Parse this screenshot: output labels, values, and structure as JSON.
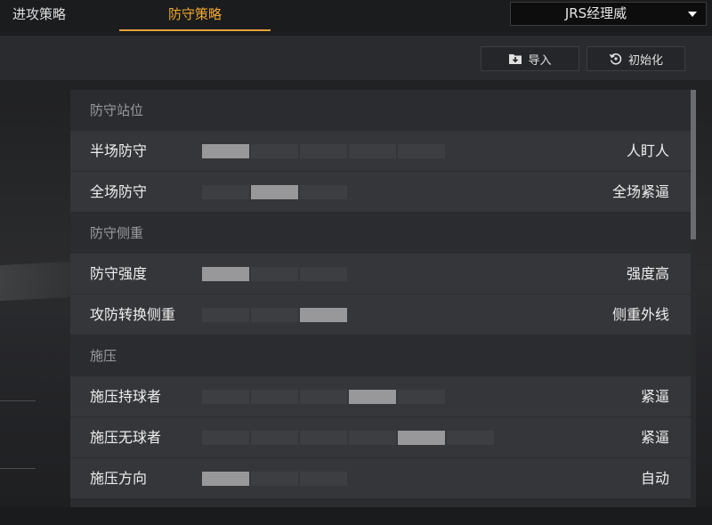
{
  "tabs": [
    {
      "label": "进攻策略"
    },
    {
      "label": "防守策略"
    }
  ],
  "accent_color": "#e3a13a",
  "dropdown": {
    "selected": "JRS经理威"
  },
  "toolbar": {
    "import_label": "导入",
    "reset_label": "初始化"
  },
  "sections": [
    {
      "title": "防守站位",
      "rows": [
        {
          "label": "半场防守",
          "value": "人盯人",
          "segments": 5,
          "selected": 1
        },
        {
          "label": "全场防守",
          "value": "全场紧逼",
          "segments": 3,
          "selected": 2
        }
      ]
    },
    {
      "title": "防守侧重",
      "rows": [
        {
          "label": "防守强度",
          "value": "强度高",
          "segments": 3,
          "selected": 1
        },
        {
          "label": "攻防转换侧重",
          "value": "侧重外线",
          "segments": 3,
          "selected": 3
        }
      ]
    },
    {
      "title": "施压",
      "rows": [
        {
          "label": "施压持球者",
          "value": "紧逼",
          "segments": 5,
          "selected": 4
        },
        {
          "label": "施压无球者",
          "value": "紧逼",
          "segments": 6,
          "selected": 5
        },
        {
          "label": "施压方向",
          "value": "自动",
          "segments": 3,
          "selected": 1
        }
      ]
    }
  ]
}
